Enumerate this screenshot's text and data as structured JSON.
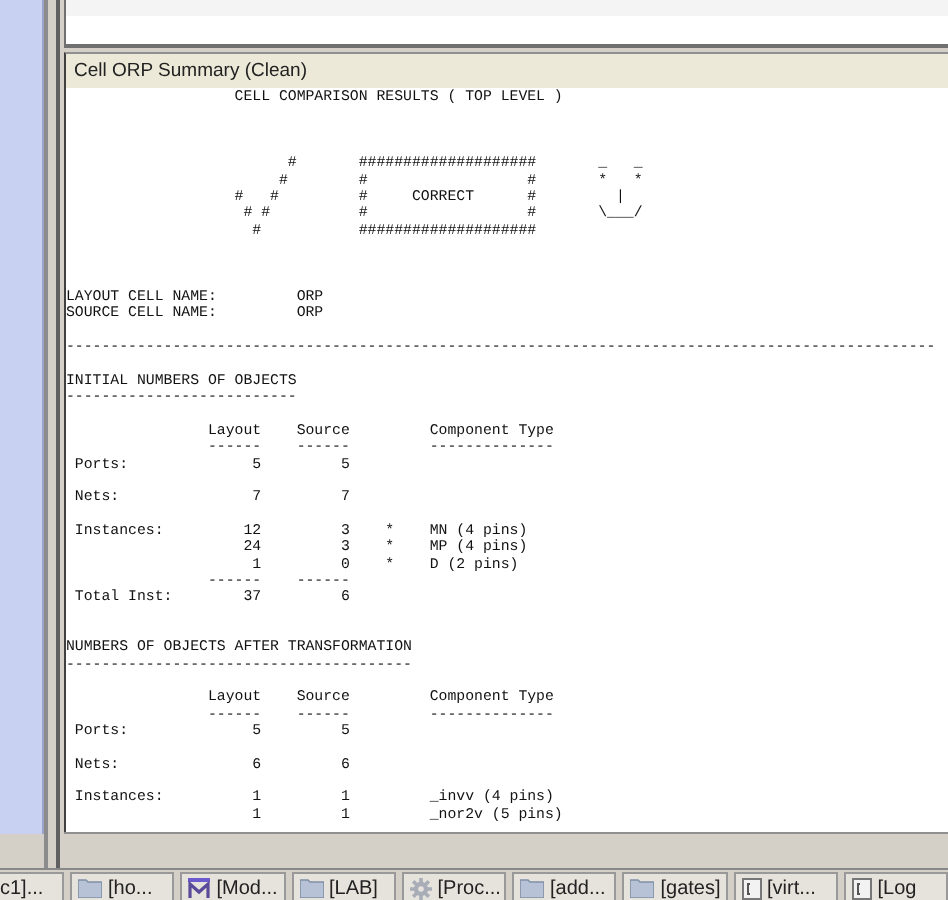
{
  "panel": {
    "title": "Cell ORP Summary (Clean)",
    "report_text": "                   CELL COMPARISON RESULTS ( TOP LEVEL )\n\n\n\n                         #       ####################       _   _\n                        #        #                  #       *   *\n                   #   #         #     CORRECT      #         |\n                    # #          #                  #       \\___/\n                     #           ####################\n\n\n\nLAYOUT CELL NAME:         ORP\nSOURCE CELL NAME:         ORP\n\n--------------------------------------------------------------------------------------------------\n\nINITIAL NUMBERS OF OBJECTS\n--------------------------\n\n                Layout    Source         Component Type\n                ------    ------         --------------\n Ports:              5         5\n\n Nets:               7         7\n\n Instances:         12         3    *    MN (4 pins)\n                    24         3    *    MP (4 pins)\n                     1         0    *    D (2 pins)\n                ------    ------\n Total Inst:        37         6\n\n\nNUMBERS OF OBJECTS AFTER TRANSFORMATION\n---------------------------------------\n\n                Layout    Source         Component Type\n                ------    ------         --------------\n Ports:              5         5\n\n Nets:               6         6\n\n Instances:          1         1         _invv (4 pins)\n                     1         1         _nor2v (5 pins)"
  },
  "taskbar": [
    {
      "label": "c1]..."
    },
    {
      "label": "[ho...",
      "kind": "folder"
    },
    {
      "label": "[Mod...",
      "kind": "m"
    },
    {
      "label": "[LAB]",
      "kind": "folder"
    },
    {
      "label": "[Proc...",
      "kind": "gear"
    },
    {
      "label": "[add...",
      "kind": "folder"
    },
    {
      "label": "[gates]",
      "kind": "folder"
    },
    {
      "label": "[virt...",
      "kind": "window"
    },
    {
      "label": "[Log",
      "kind": "window"
    }
  ]
}
